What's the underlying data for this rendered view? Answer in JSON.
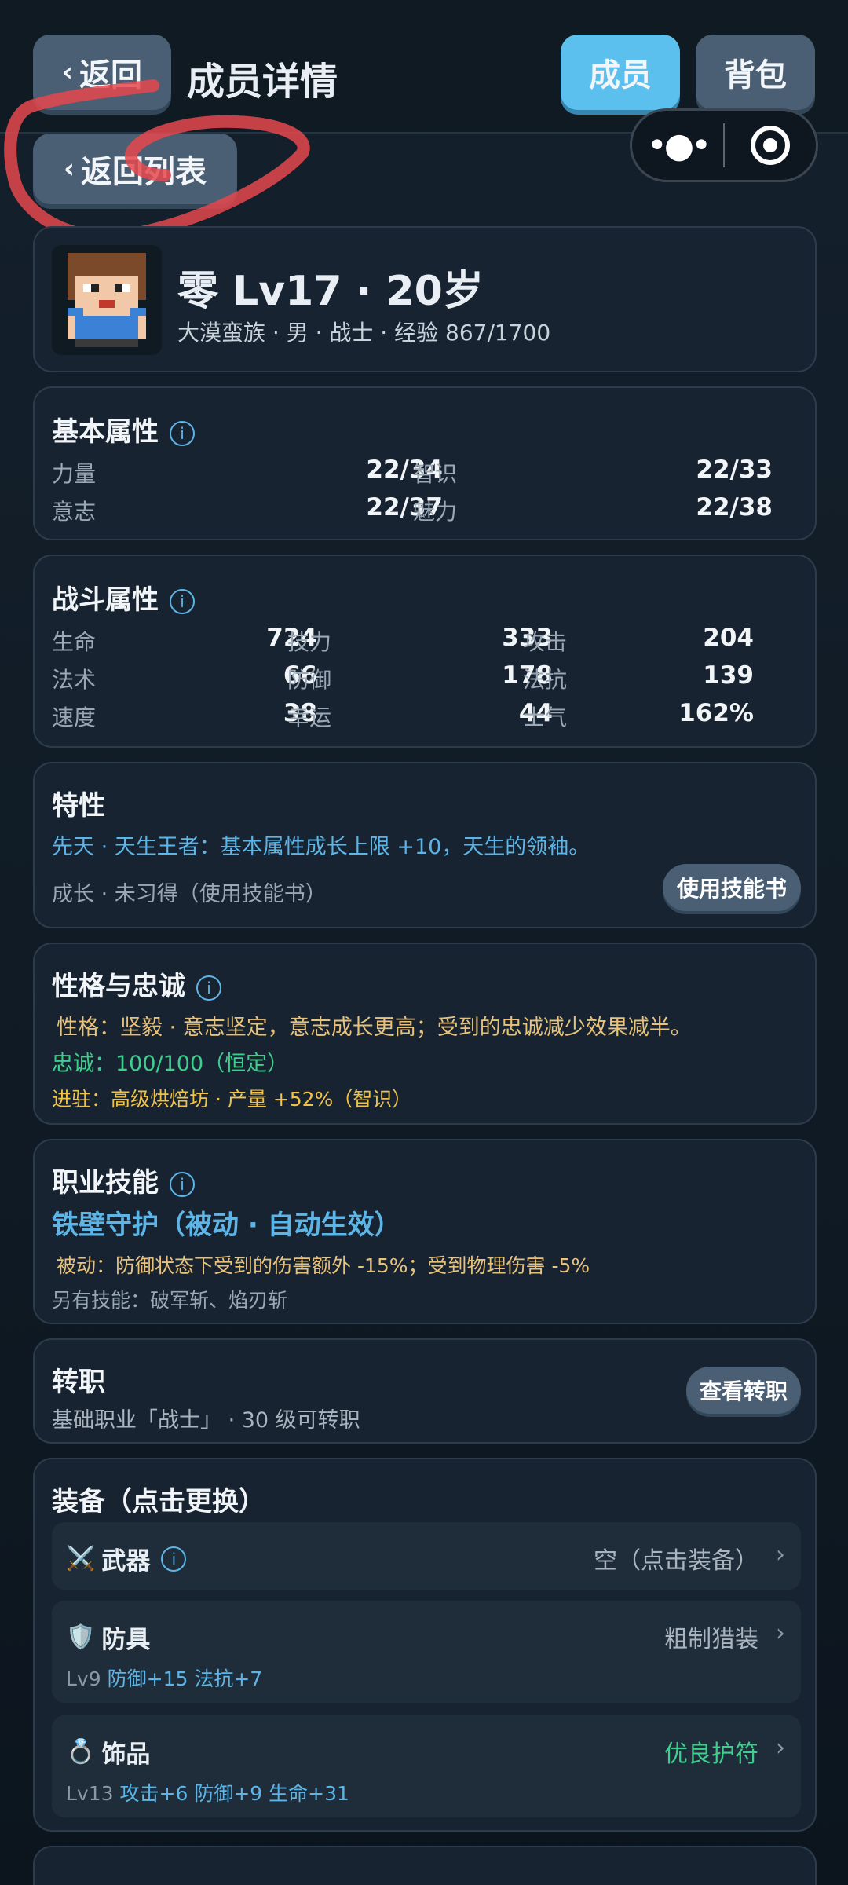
{
  "header": {
    "back_label": "返回",
    "back_list_label": "返回列表",
    "title": "成员详情",
    "tab_member": "成员",
    "tab_bag": "背包"
  },
  "hero": {
    "name_line": "零 Lv17 · 20岁",
    "sub_line": "大漠蛮族 · 男 · 战士 · 经验 867/1700"
  },
  "basic": {
    "title": "基本属性",
    "stats": [
      {
        "label": "力量",
        "value": "22/34"
      },
      {
        "label": "智识",
        "value": "22/33"
      },
      {
        "label": "意志",
        "value": "22/37"
      },
      {
        "label": "魅力",
        "value": "22/38"
      }
    ]
  },
  "combat": {
    "title": "战斗属性",
    "stats": [
      {
        "label": "生命",
        "value": "724"
      },
      {
        "label": "技力",
        "value": "333"
      },
      {
        "label": "攻击",
        "value": "204"
      },
      {
        "label": "法术",
        "value": "66"
      },
      {
        "label": "防御",
        "value": "178"
      },
      {
        "label": "法抗",
        "value": "139"
      },
      {
        "label": "速度",
        "value": "38"
      },
      {
        "label": "幸运",
        "value": "44"
      },
      {
        "label": "士气",
        "value": "162%"
      }
    ]
  },
  "trait": {
    "title": "特性",
    "innate": "先天 · 天生王者：基本属性成长上限 +10，天生的领袖。",
    "growth": "成长 · 未习得（使用技能书）",
    "button": "使用技能书"
  },
  "personality": {
    "title": "性格与忠诚",
    "nature": "性格：坚毅 · 意志坚定，意志成长更高；受到的忠诚减少效果减半。",
    "loyalty": "忠诚：100/100（恒定）",
    "station": "进驻：高级烘焙坊 · 产量 +52%（智识）"
  },
  "skill": {
    "title": "职业技能",
    "name": "铁壁守护（被动 · 自动生效）",
    "desc": "被动：防御状态下受到的伤害额外 -15%；受到物理伤害 -5%",
    "other": "另有技能：破军斩、焰刃斩"
  },
  "job": {
    "title": "转职",
    "desc": "基础职业「战士」 · 30 级可转职",
    "button": "查看转职"
  },
  "equipment": {
    "title": "装备（点击更换）",
    "weapon": {
      "icon": "⚔️",
      "name": "武器",
      "value": "空（点击装备）"
    },
    "armor": {
      "icon": "🛡️",
      "name": "防具",
      "value": "粗制猎装",
      "level": "Lv9",
      "stats": "防御+15 法抗+7"
    },
    "accessory": {
      "icon": "💍",
      "name": "饰品",
      "value": "优良护符",
      "level": "Lv13",
      "stats": "攻击+6 防御+9 生命+31",
      "value_color": "#3ecf8e"
    }
  },
  "colors": {
    "accent": "#5bc0ee",
    "loyalty": "#3ecf8e",
    "warm": "#e8c27a",
    "station": "#f0c348",
    "skill": "#5cb5e6"
  }
}
